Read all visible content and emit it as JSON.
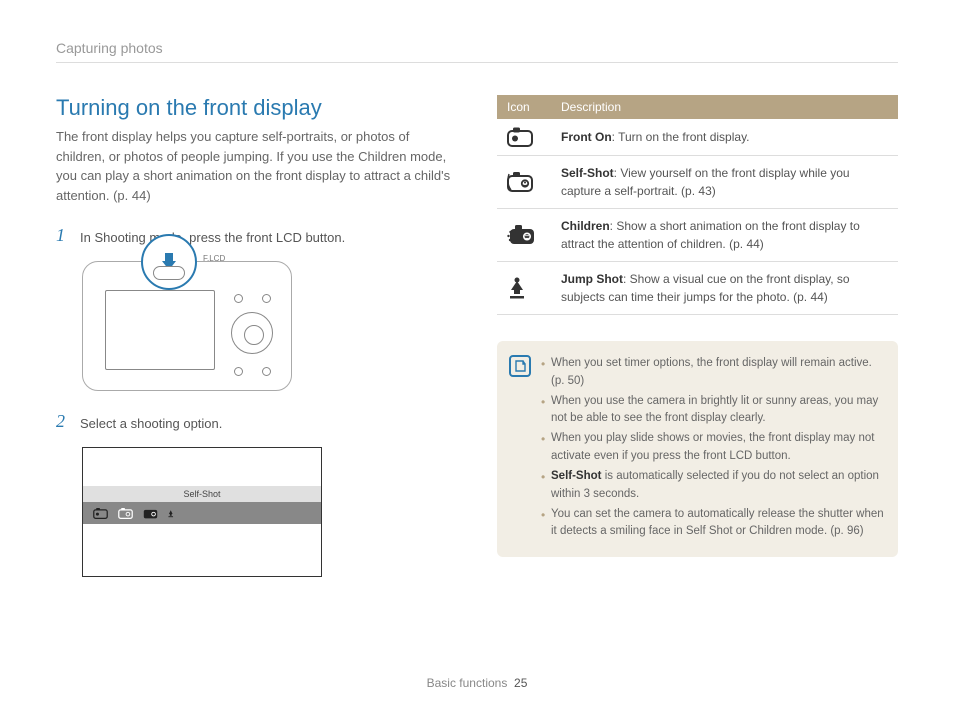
{
  "header": {
    "section": "Capturing photos"
  },
  "title": "Turning on the front display",
  "intro": "The front display helps you capture self-portraits, or photos of children, or photos of people jumping. If you use the Children mode, you can play a short animation on the front display to attract a child's attention. (p. 44)",
  "steps": {
    "s1_num": "1",
    "s1_text": "In Shooting mode, press the front LCD button.",
    "s2_num": "2",
    "s2_text": "Select a shooting option."
  },
  "camera": {
    "flcd_label": "F.LCD"
  },
  "menu": {
    "selected": "Self-Shot"
  },
  "table": {
    "h_icon": "Icon",
    "h_desc": "Description",
    "rows": [
      {
        "name": "Front On",
        "desc": ": Turn on the front display."
      },
      {
        "name": "Self-Shot",
        "desc": ": View yourself on the front display while you capture a self-portrait. (p. 43)"
      },
      {
        "name": "Children",
        "desc": ": Show a short animation on the front display to attract the attention of children. (p. 44)"
      },
      {
        "name": "Jump Shot",
        "desc": ": Show a visual cue on the front display, so subjects can time their jumps for the photo. (p. 44)"
      }
    ]
  },
  "notes": {
    "items": [
      "When you set timer options, the front display will remain active. (p. 50)",
      "When you use the camera in brightly lit or sunny areas, you may not be able to see the front display clearly.",
      "When you play slide shows or movies, the front display may not activate even if you press the front LCD button.",
      "Self-Shot is automatically selected if you do not select an option within 3 seconds.",
      "You can set the camera to automatically release the shutter when it detects a smiling face in Self Shot or Children mode. (p. 96)"
    ],
    "bold_in_3": "Self-Shot"
  },
  "footer": {
    "section": "Basic functions",
    "page": "25"
  }
}
